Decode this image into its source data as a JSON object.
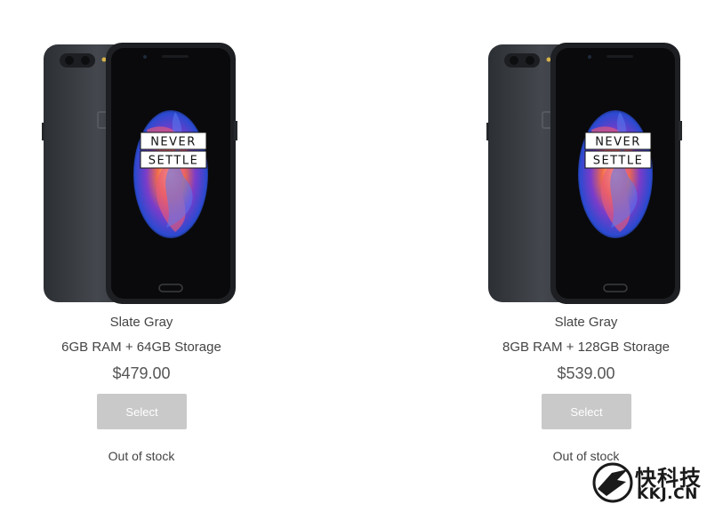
{
  "products": [
    {
      "screen_text_line1": "NEVER",
      "screen_text_line2": "SETTLE",
      "color": "Slate Gray",
      "spec": "6GB RAM + 64GB Storage",
      "price": "$479.00",
      "button_label": "Select",
      "stock": "Out of stock"
    },
    {
      "screen_text_line1": "NEVER",
      "screen_text_line2": "SETTLE",
      "color": "Slate Gray",
      "spec": "8GB RAM + 128GB Storage",
      "price": "$539.00",
      "button_label": "Select",
      "stock": "Out of stock"
    }
  ],
  "watermark": {
    "chinese": "快科技",
    "domain": "KKJ.CN"
  },
  "colors": {
    "phone_body": "#3a3d42",
    "phone_screen": "#0a0a0c",
    "button_disabled": "#c9c9c9",
    "text": "#444444"
  }
}
